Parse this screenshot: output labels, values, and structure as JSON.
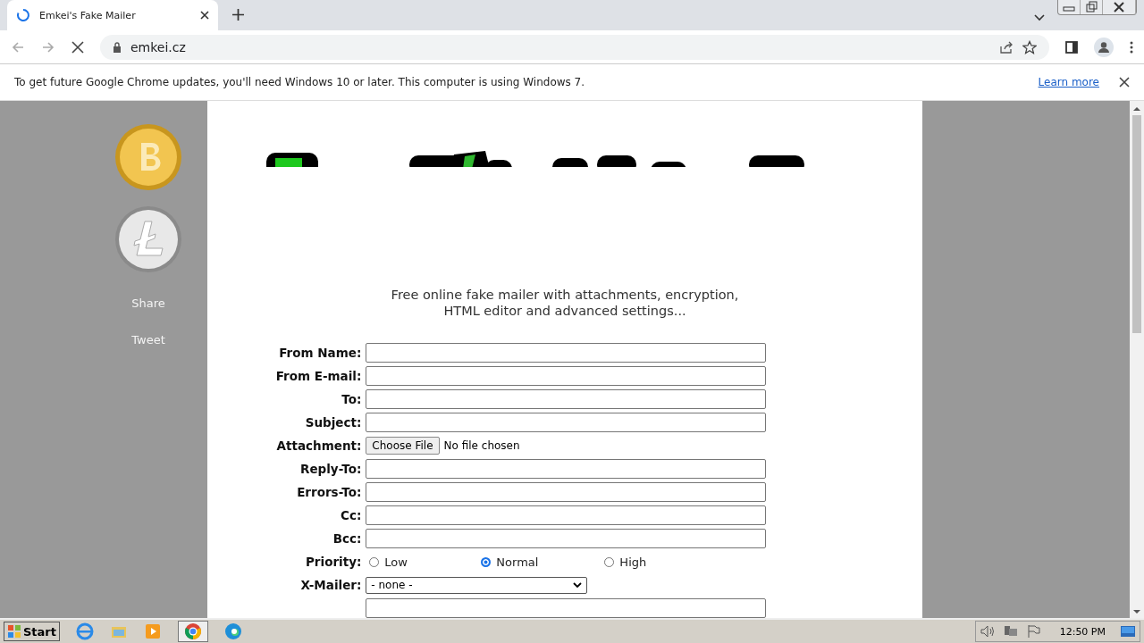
{
  "browser": {
    "tab": {
      "title": "Emkei's Fake Mailer",
      "loading": true
    },
    "url": "emkei.cz",
    "infobar": {
      "message": "To get future Google Chrome updates, you'll need Windows 10 or later. This computer is using Windows 7.",
      "link": "Learn more"
    }
  },
  "sidebar": {
    "links": [
      "Share",
      "Tweet"
    ]
  },
  "tagline": "Free online fake mailer with attachments, encryption,\nHTML editor and advanced settings...",
  "form": [
    {
      "kind": "text",
      "label": "From Name:"
    },
    {
      "kind": "text",
      "label": "From E-mail:"
    },
    {
      "kind": "text",
      "label": "To:"
    },
    {
      "kind": "text",
      "label": "Subject:"
    },
    {
      "kind": "file",
      "label": "Attachment:",
      "button": "Choose File",
      "status": "No file chosen"
    },
    {
      "kind": "text",
      "label": "Reply-To:"
    },
    {
      "kind": "text",
      "label": "Errors-To:"
    },
    {
      "kind": "text",
      "label": "Cc:"
    },
    {
      "kind": "text",
      "label": "Bcc:"
    },
    {
      "kind": "radio",
      "label": "Priority:",
      "options": [
        {
          "label": "Low",
          "selected": false
        },
        {
          "label": "Normal",
          "selected": true
        },
        {
          "label": "High",
          "selected": false
        }
      ]
    },
    {
      "kind": "select",
      "label": "X-Mailer:",
      "value": "- none -"
    },
    {
      "kind": "text"
    }
  ],
  "taskbar": {
    "start": "Start",
    "clock": "12:50 PM"
  }
}
